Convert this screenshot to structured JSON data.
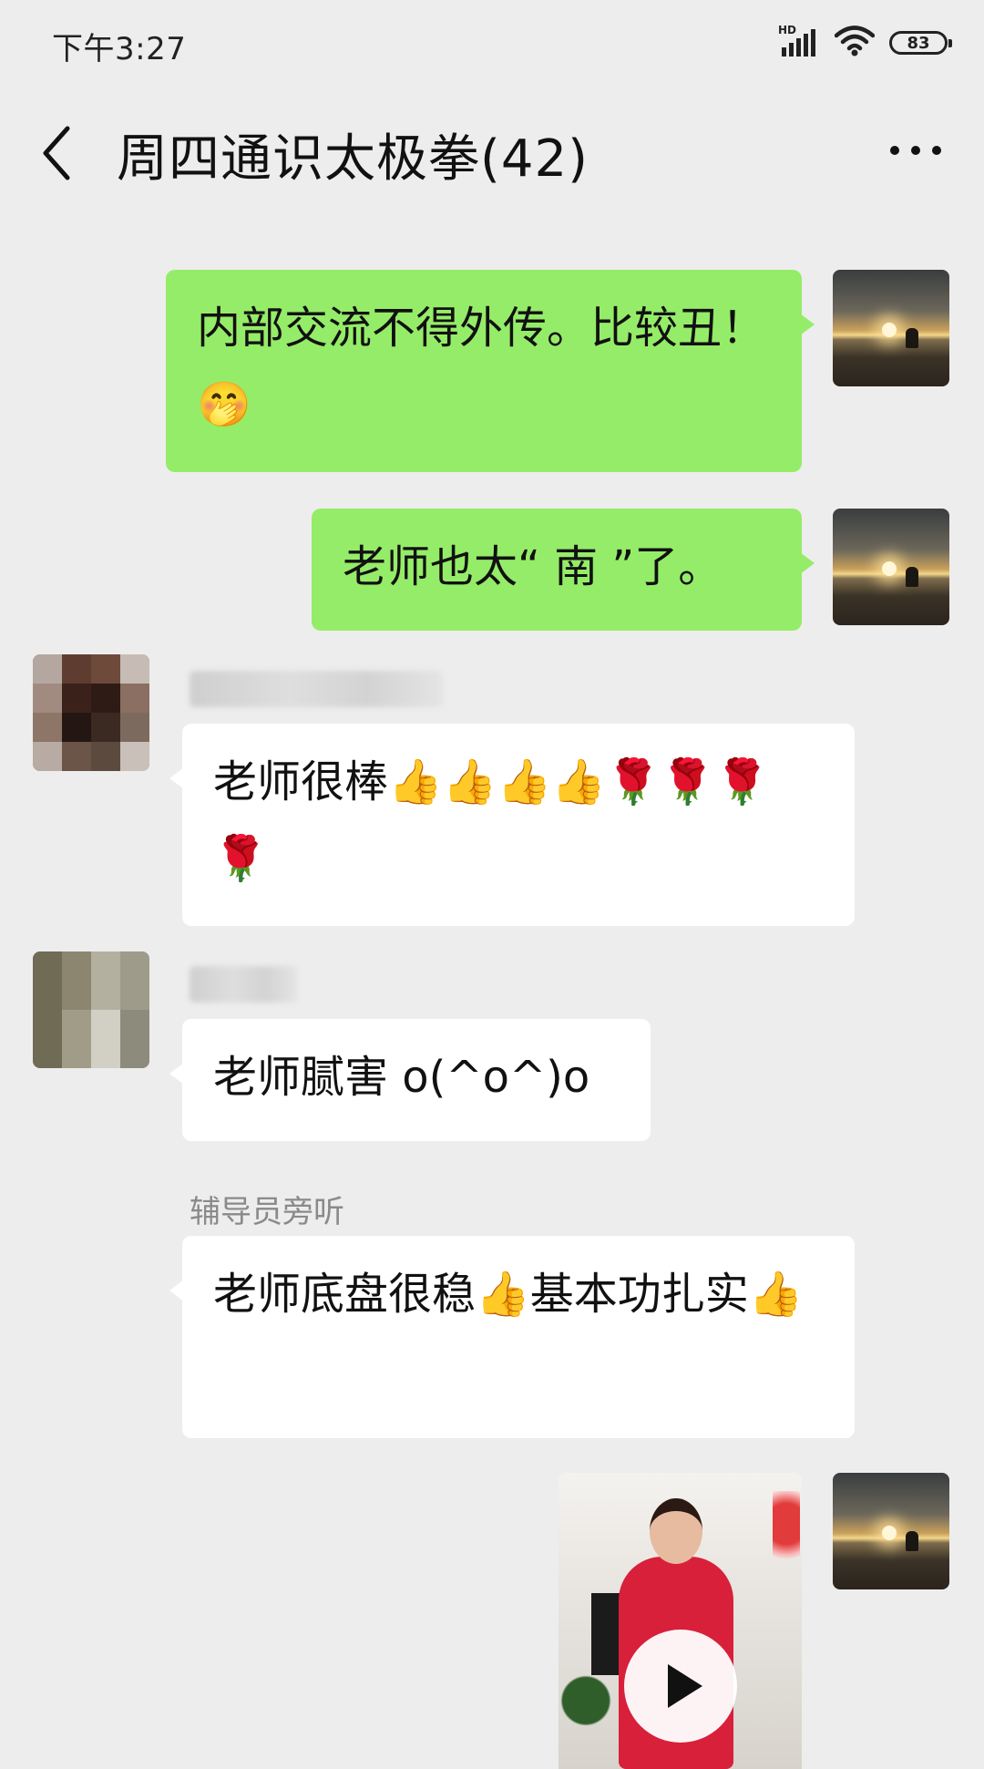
{
  "status_bar": {
    "time": "下午3:27",
    "network": "HD",
    "battery": "83"
  },
  "header": {
    "title": "周四通识太极拳(42)"
  },
  "messages": [
    {
      "direction": "out",
      "text": "内部交流不得外传。比较丑！🤭"
    },
    {
      "direction": "out",
      "text": "老师也太“ 南 ”了。"
    },
    {
      "direction": "in",
      "text": "老师很棒👍👍👍👍🌹🌹🌹🌹"
    },
    {
      "direction": "in",
      "text": "老师腻害 o(^o^)o"
    },
    {
      "direction": "in",
      "sender": "辅导员旁听",
      "text": "老师底盘很稳👍基本功扎实👍"
    },
    {
      "direction": "out",
      "type": "video"
    }
  ],
  "icons": {
    "back": "back-arrow-icon",
    "more": "more-dots-icon",
    "signal": "signal-icon",
    "wifi": "wifi-icon",
    "battery": "battery-icon",
    "play": "play-icon"
  },
  "colors": {
    "background": "#ededed",
    "outgoing_bubble": "#95ec69",
    "incoming_bubble": "#ffffff",
    "sender_name": "#8a8a8a"
  }
}
